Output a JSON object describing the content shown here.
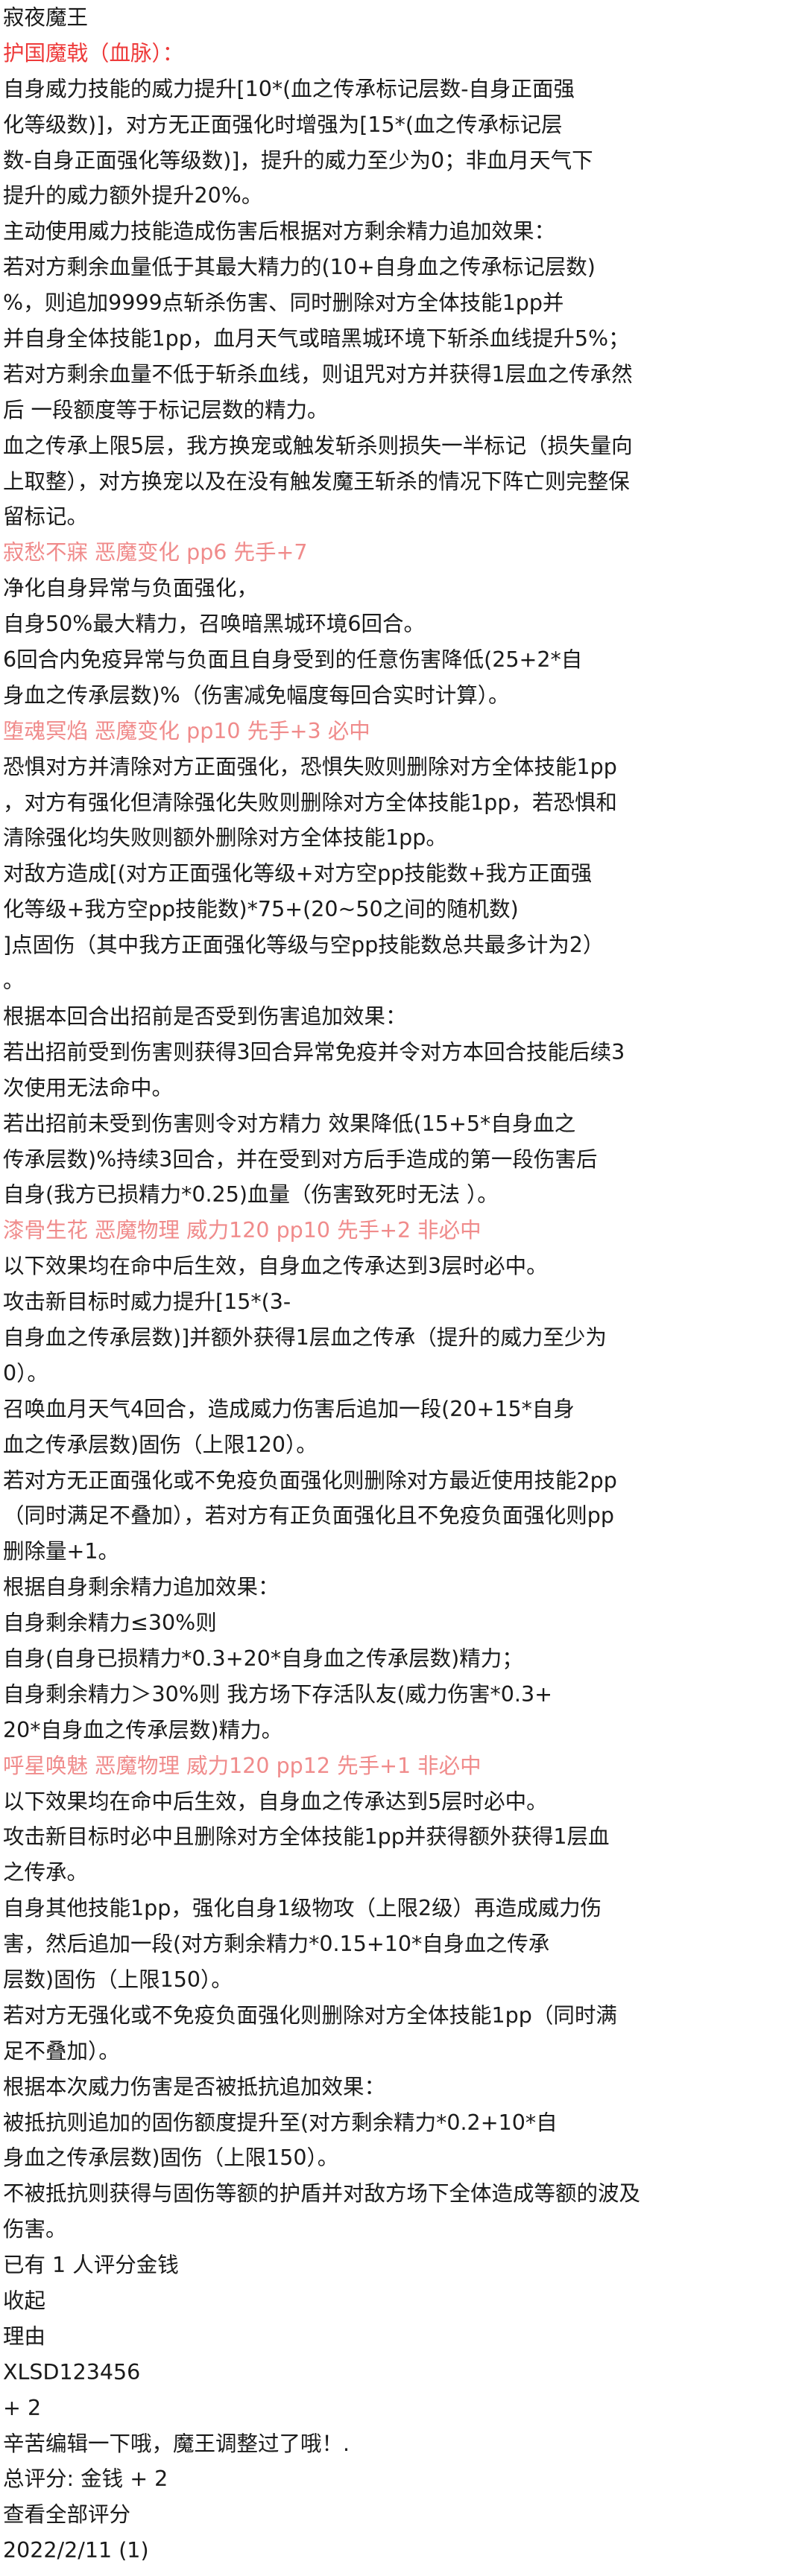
{
  "colors": {
    "text": "#1a1a1a",
    "subtitle_red": "#ee3a3a",
    "skill_pink": "#f08b8b",
    "background": "#ffffff"
  },
  "post": {
    "title": "寂夜魔王",
    "subtitle": "护国魔戟（血脉）：",
    "lines": [
      "自身威力技能的威力提升[10*(血之传承标记层数-自身正面强",
      "化等级数)]，对方无正面强化时增强为[15*(血之传承标记层",
      "数-自身正面强化等级数)]，提升的威力至少为0；非血月天气下",
      "提升的威力额外提升20%。",
      "主动使用威力技能造成伤害后根据对方剩余精力追加效果：",
      "若对方剩余血量低于其最大精力的(10+自身血之传承标记层数)",
      "%，则追加9999点斩杀伤害、同时删除对方全体技能1pp并",
      "并自身全体技能1pp，血月天气或暗黑城环境下斩杀血线提升5%；",
      "若对方剩余血量不低于斩杀血线，则诅咒对方并获得1层血之传承然",
      "后 一段额度等于标记层数的精力。",
      "血之传承上限5层，我方换宠或触发斩杀则损失一半标记（损失量向",
      "上取整），对方换宠以及在没有触发魔王斩杀的情况下阵亡则完整保",
      "留标记。"
    ],
    "skills": [
      {
        "header": "寂愁不寐 恶魔变化 pp6 先手+7",
        "lines": [
          "净化自身异常与负面强化，",
          "自身50%最大精力，召唤暗黑城环境6回合。",
          "6回合内免疫异常与负面且自身受到的任意伤害降低(25+2*自",
          "身血之传承层数)%（伤害减免幅度每回合实时计算）。"
        ]
      },
      {
        "header": "堕魂冥焰 恶魔变化 pp10 先手+3 必中",
        "lines": [
          "恐惧对方并清除对方正面强化，恐惧失败则删除对方全体技能1pp",
          "，对方有强化但清除强化失败则删除对方全体技能1pp，若恐惧和",
          "清除强化均失败则额外删除对方全体技能1pp。",
          "对敌方造成[(对方正面强化等级+对方空pp技能数+我方正面强",
          "化等级+我方空pp技能数)*75+(20~50之间的随机数)",
          "]点固伤（其中我方正面强化等级与空pp技能数总共最多计为2）",
          "。",
          "根据本回合出招前是否受到伤害追加效果：",
          "若出招前受到伤害则获得3回合异常免疫并令对方本回合技能后续3",
          "次使用无法命中。",
          "若出招前未受到伤害则令对方精力 效果降低(15+5*自身血之",
          "传承层数)%持续3回合，并在受到对方后手造成的第一段伤害后",
          "自身(我方已损精力*0.25)血量（伤害致死时无法 ）。"
        ]
      },
      {
        "header": "漆骨生花 恶魔物理 威力120 pp10 先手+2 非必中",
        "lines": [
          "以下效果均在命中后生效，自身血之传承达到3层时必中。",
          "攻击新目标时威力提升[15*(3-",
          "自身血之传承层数)]并额外获得1层血之传承（提升的威力至少为",
          "0）。",
          "召唤血月天气4回合，造成威力伤害后追加一段(20+15*自身",
          "血之传承层数)固伤（上限120）。",
          "若对方无正面强化或不免疫负面强化则删除对方最近使用技能2pp",
          "（同时满足不叠加），若对方有正负面强化且不免疫负面强化则pp",
          "删除量+1。",
          "根据自身剩余精力追加效果：",
          "自身剩余精力≤30%则",
          "自身(自身已损精力*0.3+20*自身血之传承层数)精力；",
          "自身剩余精力＞30%则 我方场下存活队友(威力伤害*0.3+",
          "20*自身血之传承层数)精力。"
        ]
      },
      {
        "header": "呼星唤魅 恶魔物理 威力120 pp12 先手+1 非必中",
        "lines": [
          "以下效果均在命中后生效，自身血之传承达到5层时必中。",
          "攻击新目标时必中且删除对方全体技能1pp并获得额外获得1层血",
          "之传承。",
          "自身其他技能1pp，强化自身1级物攻（上限2级）再造成威力伤",
          "害，然后追加一段(对方剩余精力*0.15+10*自身血之传承",
          "层数)固伤（上限150）。",
          "若对方无强化或不免疫负面强化则删除对方全体技能1pp（同时满",
          "足不叠加）。",
          "根据本次威力伤害是否被抵抗追加效果：",
          "被抵抗则追加的固伤额度提升至(对方剩余精力*0.2+10*自",
          "身血之传承层数)固伤（上限150）。",
          "不被抵抗则获得与固伤等额的护盾并对敌方场下全体造成等额的波及",
          "伤害。"
        ]
      }
    ]
  },
  "rating": {
    "summary": "已有 1 人评分金钱",
    "collapse_label": "收起",
    "reason_header": "理由",
    "rater": "XLSD123456",
    "score": "+ 2",
    "comment": "辛苦编辑一下哦，魔王调整过了哦！.",
    "total": "总评分: 金钱 + 2",
    "view_all_label": "查看全部评分",
    "date": "2022/2/11 (1)"
  }
}
